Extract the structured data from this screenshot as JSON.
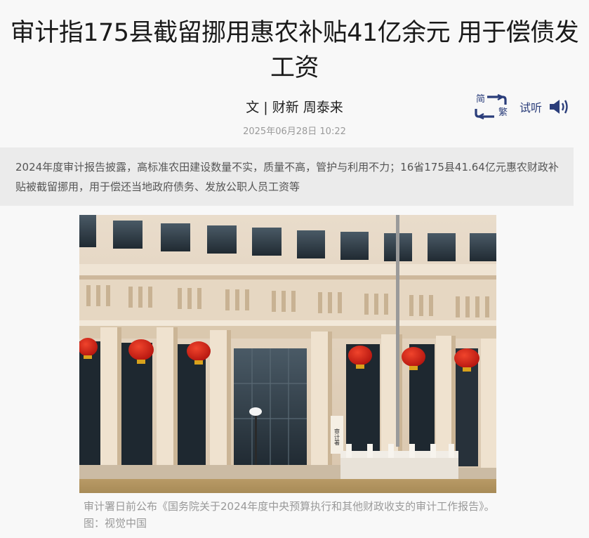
{
  "article": {
    "title": "审计指175县截留挪用惠农补贴41亿余元 用于偿债发工资",
    "byline": "文 | 财新 周泰来",
    "date": "2025年06月28日 10:22",
    "summary": "2024年度审计报告披露，高标准农田建设数量不实，质量不高，管护与利用不力；16省175县41.64亿元惠农财政补贴被截留挪用，用于偿还当地政府债务、发放公职人员工资等",
    "caption": "审计署日前公布《国务院关于2024年度中央预算执行和其他财政收支的审计工作报告》。图：视觉中国"
  },
  "tools": {
    "convert_simplified": "简",
    "convert_traditional": "繁",
    "listen_label": "试听",
    "convert_icon": "simplified-traditional-convert-icon",
    "speaker_icon": "speaker-icon"
  },
  "photo": {
    "sign_text": "审计署",
    "description_icon": "building-photo"
  },
  "colors": {
    "accent": "#2a3d7a",
    "summary_bg": "#ebebeb",
    "page_bg": "#f8f8f8",
    "meta_text": "#9a9a9a"
  }
}
